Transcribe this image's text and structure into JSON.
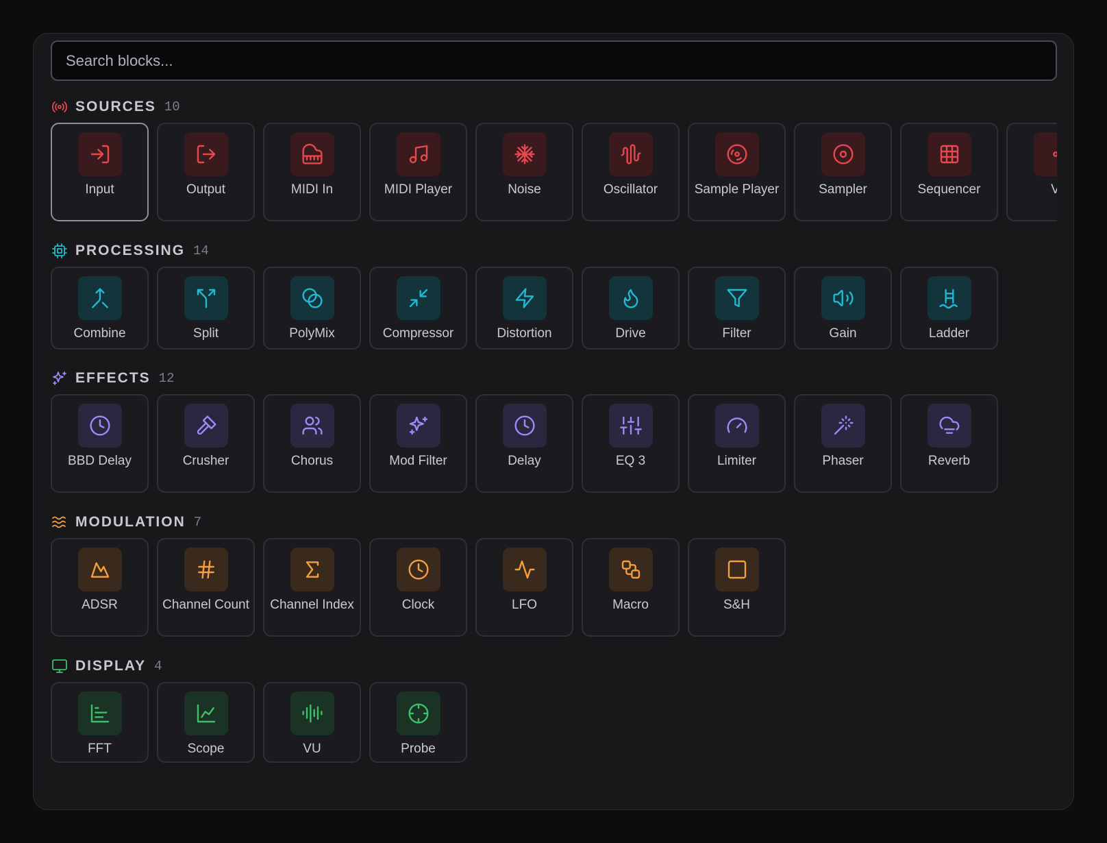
{
  "search": {
    "placeholder": "Search blocks..."
  },
  "sections": [
    {
      "key": "sources",
      "title": "SOURCES",
      "count": "10",
      "icon": "broadcast-icon",
      "color": "#e5484d",
      "tint": "#3b1a1e",
      "items": [
        {
          "label": "Input",
          "icon": "login-icon"
        },
        {
          "label": "Output",
          "icon": "logout-icon"
        },
        {
          "label": "MIDI In",
          "icon": "piano-icon"
        },
        {
          "label": "MIDI Player",
          "icon": "music-note-icon"
        },
        {
          "label": "Noise",
          "icon": "snowflake-icon"
        },
        {
          "label": "Oscillator",
          "icon": "waveform-icon"
        },
        {
          "label": "Sample Player",
          "icon": "disc-icon"
        },
        {
          "label": "Sampler",
          "icon": "target-icon"
        },
        {
          "label": "Sequencer",
          "icon": "grid-icon"
        },
        {
          "label": "V",
          "icon": "unknown-icon"
        }
      ]
    },
    {
      "key": "processing",
      "title": "PROCESSING",
      "count": "14",
      "icon": "cpu-icon",
      "color": "#22b8cf",
      "tint": "#14343b",
      "items": [
        {
          "label": "Combine",
          "icon": "merge-icon"
        },
        {
          "label": "Split",
          "icon": "split-icon"
        },
        {
          "label": "PolyMix",
          "icon": "circles-overlap-icon"
        },
        {
          "label": "Compressor",
          "icon": "compress-arrows-icon"
        },
        {
          "label": "Distortion",
          "icon": "lightning-icon"
        },
        {
          "label": "Drive",
          "icon": "flame-icon"
        },
        {
          "label": "Filter",
          "icon": "funnel-icon"
        },
        {
          "label": "Gain",
          "icon": "volume-icon"
        },
        {
          "label": "Ladder",
          "icon": "ladder-icon"
        }
      ]
    },
    {
      "key": "effects",
      "title": "EFFECTS",
      "count": "12",
      "icon": "sparkles-icon",
      "color": "#9b8cf5",
      "tint": "#2b2740",
      "items": [
        {
          "label": "BBD Delay",
          "icon": "clock-icon"
        },
        {
          "label": "Crusher",
          "icon": "hammer-icon"
        },
        {
          "label": "Chorus",
          "icon": "users-icon"
        },
        {
          "label": "Mod Filter",
          "icon": "sparkles-icon"
        },
        {
          "label": "Delay",
          "icon": "clock-icon"
        },
        {
          "label": "EQ 3",
          "icon": "sliders-icon"
        },
        {
          "label": "Limiter",
          "icon": "gauge-icon"
        },
        {
          "label": "Phaser",
          "icon": "magic-wand-icon"
        },
        {
          "label": "Reverb",
          "icon": "cloud-icon"
        }
      ]
    },
    {
      "key": "modulation",
      "title": "MODULATION",
      "count": "7",
      "icon": "waves-icon",
      "color": "#f59e42",
      "tint": "#3a2a1d",
      "items": [
        {
          "label": "ADSR",
          "icon": "envelope-shape-icon"
        },
        {
          "label": "Channel Count",
          "icon": "hash-icon"
        },
        {
          "label": "Channel Index",
          "icon": "sigma-icon"
        },
        {
          "label": "Clock",
          "icon": "clock-icon"
        },
        {
          "label": "LFO",
          "icon": "pulse-icon"
        },
        {
          "label": "Macro",
          "icon": "link-boxes-icon"
        },
        {
          "label": "S&H",
          "icon": "square-icon"
        }
      ]
    },
    {
      "key": "display",
      "title": "DISPLAY",
      "count": "4",
      "icon": "monitor-icon",
      "color": "#3fbf6a",
      "tint": "#1a3324",
      "items": [
        {
          "label": "FFT",
          "icon": "bar-chart-icon"
        },
        {
          "label": "Scope",
          "icon": "line-chart-icon"
        },
        {
          "label": "VU",
          "icon": "audio-lines-icon"
        },
        {
          "label": "Probe",
          "icon": "crosshair-icon"
        }
      ]
    }
  ]
}
